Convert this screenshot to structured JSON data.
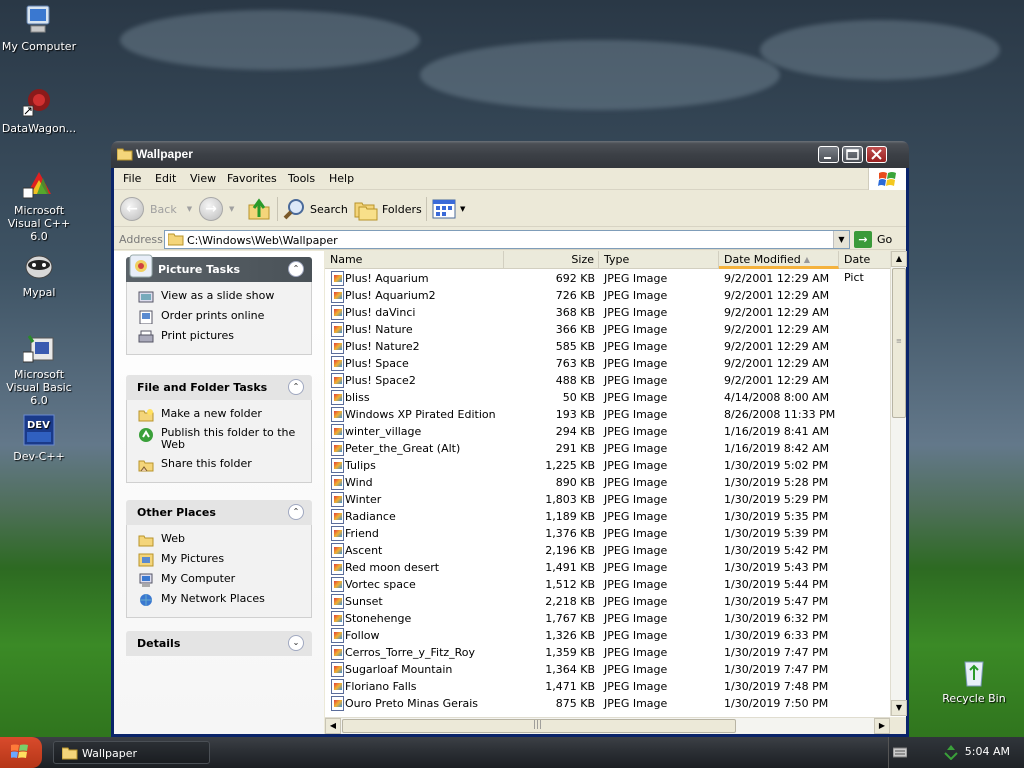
{
  "desktop": {
    "icons": [
      {
        "label": "My Computer"
      },
      {
        "label": "DataWagon..."
      },
      {
        "label": "Microsoft Visual C++ 6.0"
      },
      {
        "label": "Mypal"
      },
      {
        "label": "Microsoft Visual Basic 6.0"
      },
      {
        "label": "Dev-C++"
      },
      {
        "label": "Recycle Bin"
      }
    ]
  },
  "window": {
    "title": "Wallpaper",
    "menu": [
      "File",
      "Edit",
      "View",
      "Favorites",
      "Tools",
      "Help"
    ],
    "toolbar": {
      "back_label": "Back",
      "search_label": "Search",
      "folders_label": "Folders"
    },
    "address": {
      "label": "Address",
      "value": "C:\\Windows\\Web\\Wallpaper",
      "go_label": "Go"
    }
  },
  "taskpane": {
    "picture_tasks": {
      "title": "Picture Tasks",
      "items": [
        "View as a slide show",
        "Order prints online",
        "Print pictures"
      ]
    },
    "file_folder_tasks": {
      "title": "File and Folder Tasks",
      "items": [
        "Make a new folder",
        "Publish this folder to the Web",
        "Share this folder"
      ]
    },
    "other_places": {
      "title": "Other Places",
      "items": [
        "Web",
        "My Pictures",
        "My Computer",
        "My Network Places"
      ]
    },
    "details": {
      "title": "Details"
    }
  },
  "filelist": {
    "columns": [
      "Name",
      "Size",
      "Type",
      "Date Modified",
      "Date Pict"
    ],
    "sorted_column": "Date Modified",
    "rows": [
      {
        "name": "Plus! Aquarium",
        "size": "692 KB",
        "type": "JPEG Image",
        "date": "9/2/2001 12:29 AM"
      },
      {
        "name": "Plus! Aquarium2",
        "size": "726 KB",
        "type": "JPEG Image",
        "date": "9/2/2001 12:29 AM"
      },
      {
        "name": "Plus! daVinci",
        "size": "368 KB",
        "type": "JPEG Image",
        "date": "9/2/2001 12:29 AM"
      },
      {
        "name": "Plus! Nature",
        "size": "366 KB",
        "type": "JPEG Image",
        "date": "9/2/2001 12:29 AM"
      },
      {
        "name": "Plus! Nature2",
        "size": "585 KB",
        "type": "JPEG Image",
        "date": "9/2/2001 12:29 AM"
      },
      {
        "name": "Plus! Space",
        "size": "763 KB",
        "type": "JPEG Image",
        "date": "9/2/2001 12:29 AM"
      },
      {
        "name": "Plus! Space2",
        "size": "488 KB",
        "type": "JPEG Image",
        "date": "9/2/2001 12:29 AM"
      },
      {
        "name": "bliss",
        "size": "50 KB",
        "type": "JPEG Image",
        "date": "4/14/2008 8:00 AM"
      },
      {
        "name": "Windows XP Pirated Edition",
        "size": "193 KB",
        "type": "JPEG Image",
        "date": "8/26/2008 11:33 PM"
      },
      {
        "name": "winter_village",
        "size": "294 KB",
        "type": "JPEG Image",
        "date": "1/16/2019 8:41 AM"
      },
      {
        "name": "Peter_the_Great (Alt)",
        "size": "291 KB",
        "type": "JPEG Image",
        "date": "1/16/2019 8:42 AM"
      },
      {
        "name": "Tulips",
        "size": "1,225 KB",
        "type": "JPEG Image",
        "date": "1/30/2019 5:02 PM"
      },
      {
        "name": "Wind",
        "size": "890 KB",
        "type": "JPEG Image",
        "date": "1/30/2019 5:28 PM"
      },
      {
        "name": "Winter",
        "size": "1,803 KB",
        "type": "JPEG Image",
        "date": "1/30/2019 5:29 PM"
      },
      {
        "name": "Radiance",
        "size": "1,189 KB",
        "type": "JPEG Image",
        "date": "1/30/2019 5:35 PM"
      },
      {
        "name": "Friend",
        "size": "1,376 KB",
        "type": "JPEG Image",
        "date": "1/30/2019 5:39 PM"
      },
      {
        "name": "Ascent",
        "size": "2,196 KB",
        "type": "JPEG Image",
        "date": "1/30/2019 5:42 PM"
      },
      {
        "name": "Red moon desert",
        "size": "1,491 KB",
        "type": "JPEG Image",
        "date": "1/30/2019 5:43 PM"
      },
      {
        "name": "Vortec space",
        "size": "1,512 KB",
        "type": "JPEG Image",
        "date": "1/30/2019 5:44 PM"
      },
      {
        "name": "Sunset",
        "size": "2,218 KB",
        "type": "JPEG Image",
        "date": "1/30/2019 5:47 PM"
      },
      {
        "name": "Stonehenge",
        "size": "1,767 KB",
        "type": "JPEG Image",
        "date": "1/30/2019 6:32 PM"
      },
      {
        "name": "Follow",
        "size": "1,326 KB",
        "type": "JPEG Image",
        "date": "1/30/2019 6:33 PM"
      },
      {
        "name": "Cerros_Torre_y_Fitz_Roy",
        "size": "1,359 KB",
        "type": "JPEG Image",
        "date": "1/30/2019 7:47 PM"
      },
      {
        "name": "Sugarloaf Mountain",
        "size": "1,364 KB",
        "type": "JPEG Image",
        "date": "1/30/2019 7:47 PM"
      },
      {
        "name": "Floriano Falls",
        "size": "1,471 KB",
        "type": "JPEG Image",
        "date": "1/30/2019 7:48 PM"
      },
      {
        "name": "Ouro Preto Minas Gerais",
        "size": "875 KB",
        "type": "JPEG Image",
        "date": "1/30/2019 7:50 PM"
      }
    ]
  },
  "taskbar": {
    "window_button": "Wallpaper",
    "clock": "5:04 AM"
  },
  "colors": {
    "titlebar": "#3c4046",
    "start": "#c8411f",
    "sort_accent": "#f4b23d",
    "link_blue": "#215dc6"
  }
}
